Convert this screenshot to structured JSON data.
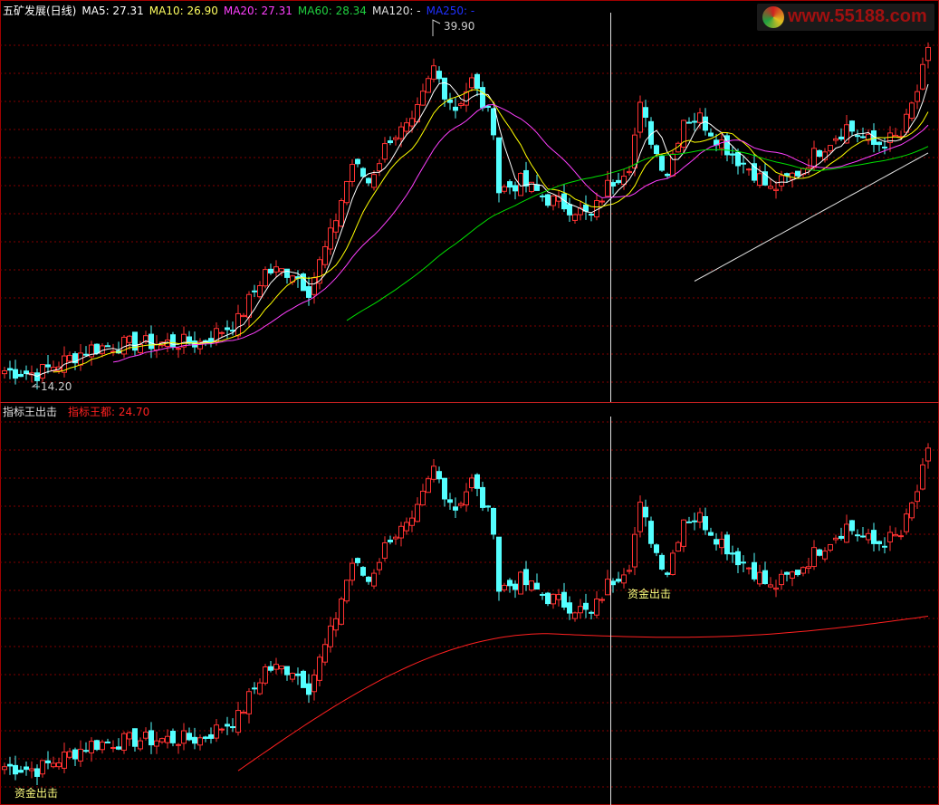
{
  "header": {
    "stock": "五矿发展(日线)",
    "ma5": "MA5: 27.31",
    "ma10": "MA10: 26.90",
    "ma20": "MA20: 27.31",
    "ma60": "MA60: 28.34",
    "ma120": "MA120: -",
    "ma250": "MA250: -"
  },
  "lower_header": {
    "name": "指标王出击",
    "line": "指标王都: 24.70"
  },
  "logo_text": "www.55188.com",
  "annotations": {
    "high": "39.90",
    "low": "14.20",
    "signal": "资金出击"
  },
  "colors": {
    "up": "#ff3232",
    "down": "#54ffff",
    "ma5": "#ffffff",
    "ma10": "#ffff00",
    "ma20": "#ff40ff",
    "ma60": "#00e000",
    "ma120": "#e0e0e0",
    "indicator": "#ff2020",
    "grid": "#800000"
  },
  "chart_data": {
    "type": "candlestick",
    "title": "五矿发展(日线)",
    "candle_count": 171,
    "close_keypoints": [
      [
        0,
        15.2
      ],
      [
        6,
        15.0
      ],
      [
        16,
        16.8
      ],
      [
        24,
        17.1
      ],
      [
        36,
        17.2
      ],
      [
        43,
        18.7
      ],
      [
        48,
        22.2
      ],
      [
        53,
        22.2
      ],
      [
        56,
        20.9
      ],
      [
        60,
        24.7
      ],
      [
        64,
        29.8
      ],
      [
        67,
        28.5
      ],
      [
        71,
        31.7
      ],
      [
        75,
        32.4
      ],
      [
        79,
        36.5
      ],
      [
        81,
        34.9
      ],
      [
        83,
        33.7
      ],
      [
        86,
        35.6
      ],
      [
        90,
        32.4
      ],
      [
        91,
        27.9
      ],
      [
        95,
        28.5
      ],
      [
        100,
        27.3
      ],
      [
        105,
        26.6
      ],
      [
        108,
        26.0
      ],
      [
        111,
        28.2
      ],
      [
        115,
        29.8
      ],
      [
        117,
        33.7
      ],
      [
        120,
        30.5
      ],
      [
        122,
        29.2
      ],
      [
        125,
        33.0
      ],
      [
        128,
        33.0
      ],
      [
        131,
        31.7
      ],
      [
        135,
        30.1
      ],
      [
        138,
        29.2
      ],
      [
        141,
        27.9
      ],
      [
        146,
        29.2
      ],
      [
        150,
        30.8
      ],
      [
        155,
        32.4
      ],
      [
        160,
        31.1
      ],
      [
        165,
        31.7
      ],
      [
        168,
        34.9
      ],
      [
        170,
        37.5
      ]
    ],
    "high": 39.9,
    "low": 14.2,
    "ylim": [
      14.0,
      40.5
    ],
    "moving_averages": {
      "MA5": 27.31,
      "MA10": 26.9,
      "MA20": 27.31,
      "MA60": 28.34
    },
    "indicator_last": 24.7
  }
}
